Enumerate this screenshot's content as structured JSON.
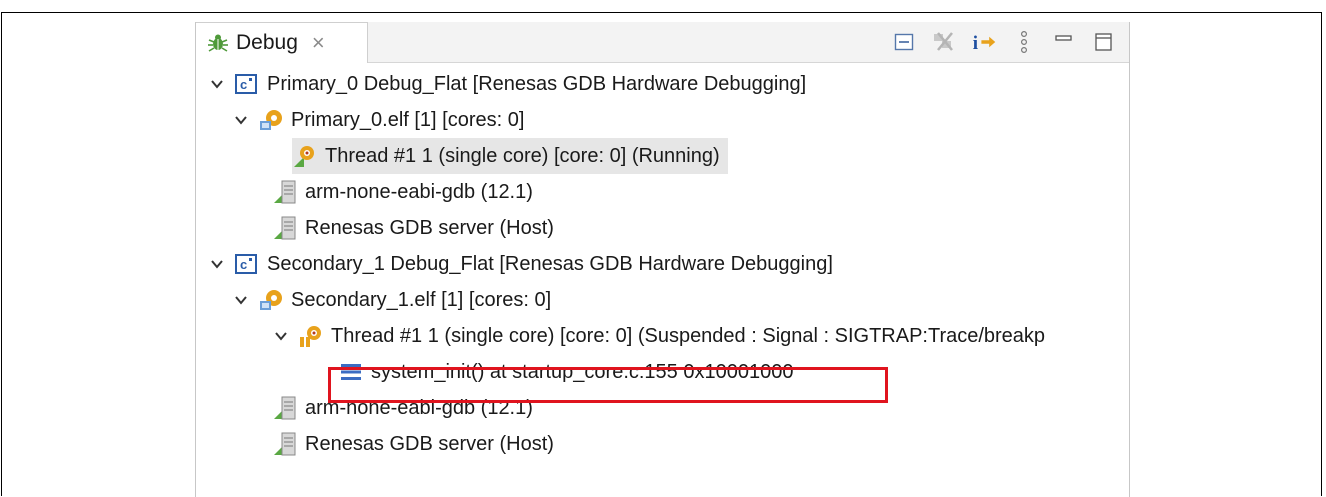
{
  "tab": {
    "label": "Debug",
    "close": "×"
  },
  "toolbar": {
    "icons": [
      "collapse-all-icon",
      "remove-terminated-icon",
      "step-into-instruction-icon",
      "view-menu-icon",
      "minimize-icon",
      "maximize-icon"
    ]
  },
  "tree": {
    "primary": {
      "label": "Primary_0 Debug_Flat [Renesas GDB Hardware Debugging]",
      "elf": "Primary_0.elf [1] [cores: 0]",
      "thread": "Thread #1 1 (single core) [core: 0] (Running)",
      "gdb": "arm-none-eabi-gdb (12.1)",
      "server": "Renesas GDB server (Host)"
    },
    "secondary": {
      "label": "Secondary_1 Debug_Flat [Renesas GDB Hardware Debugging]",
      "elf": "Secondary_1.elf [1] [cores: 0]",
      "thread": "Thread #1 1 (single core) [core: 0] (Suspended : Signal : SIGTRAP:Trace/breakp",
      "frame": "system_init() at startup_core.c:155 0x10001000",
      "gdb": "arm-none-eabi-gdb (12.1)",
      "server": "Renesas GDB server (Host)"
    }
  },
  "colors": {
    "highlight_border": "#e0141e",
    "selection_bg": "#e6e6e6",
    "launch_icon_blue": "#2a5ca8"
  }
}
